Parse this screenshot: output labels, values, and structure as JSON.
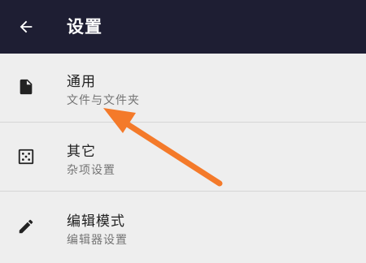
{
  "header": {
    "title": "设置",
    "back_icon": "arrow-left-icon"
  },
  "settings": [
    {
      "title": "通用",
      "subtitle": "文件与文件夹",
      "icon": "file-icon"
    },
    {
      "title": "其它",
      "subtitle": "杂项设置",
      "icon": "dice-icon"
    },
    {
      "title": "编辑模式",
      "subtitle": "编辑器设置",
      "icon": "pencil-icon"
    }
  ],
  "colors": {
    "topbar_bg": "#1e1e33",
    "background": "#eeeeee",
    "title_text": "#212121",
    "subtitle_text": "#757575",
    "annotation_arrow": "#f47a2a"
  }
}
